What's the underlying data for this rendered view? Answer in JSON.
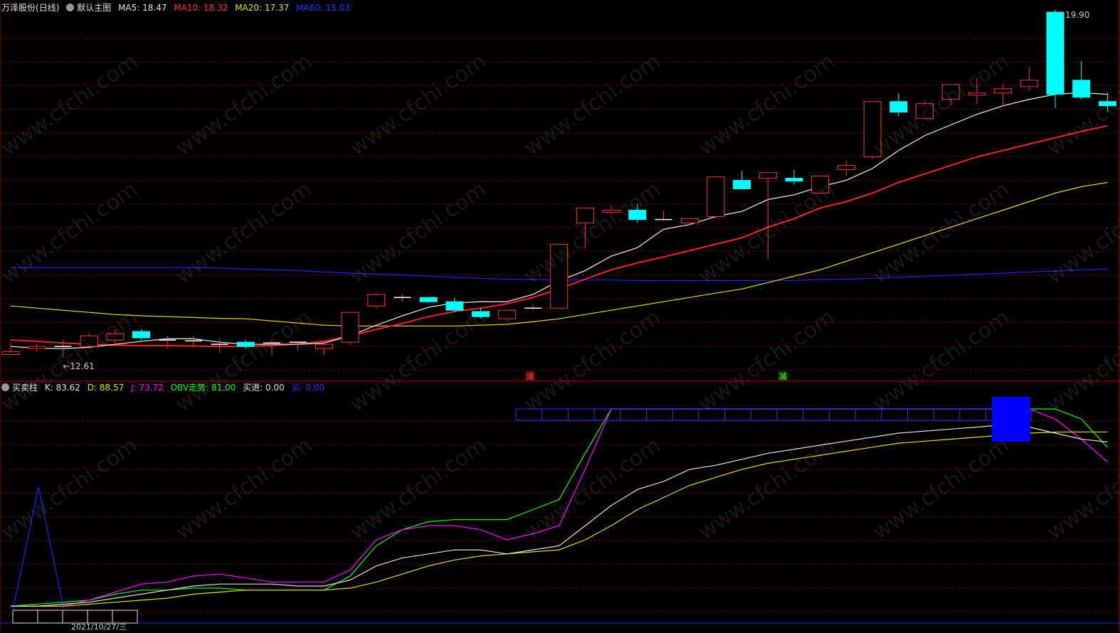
{
  "header_top": {
    "stock": "万泽股份",
    "period": "(日线)",
    "chart_name": "默认主图",
    "ma5": "MA5: 18.47",
    "ma10": "MA10: 18.32",
    "ma20": "MA20: 17.37",
    "ma60": "MA60: 15.03"
  },
  "header_bottom": {
    "name": "买卖柱",
    "k": "K: 83.62",
    "d": "D: 88.57",
    "j": "J: 73.72",
    "obv": "OBV走势: 81.00",
    "buy_in": "买进: 0.00",
    "buy": "买: 0.00"
  },
  "markers": {
    "high": "19.90",
    "low": "12.61",
    "zhang": "涨",
    "jian": "减"
  },
  "bottom_date": "2021/10/27/三",
  "watermark": "www.cfchi.com",
  "colors": {
    "up": "#ff3232",
    "down": "#00ffff",
    "ma5": "#e0e0e0",
    "ma10": "#ff2020",
    "ma20": "#e0e000",
    "ma60": "#2020ff",
    "k": "#e0e0e0",
    "d": "#e0e000",
    "j": "#ff00ff",
    "obv": "#00ff00",
    "grid": "#6a0000"
  },
  "chart_data": [
    {
      "type": "candlestick",
      "title": "万泽股份 (日线)",
      "ylim": [
        12.0,
        20.6
      ],
      "ohlc": [
        [
          12.61,
          12.88,
          12.61,
          12.68
        ],
        [
          12.75,
          12.85,
          12.68,
          12.8
        ],
        [
          12.8,
          12.95,
          12.55,
          12.8
        ],
        [
          12.8,
          13.1,
          12.75,
          13.05
        ],
        [
          12.95,
          13.2,
          12.85,
          13.1
        ],
        [
          13.15,
          13.2,
          12.95,
          13.0
        ],
        [
          12.95,
          13.05,
          12.75,
          12.95
        ],
        [
          12.93,
          13.05,
          12.78,
          12.93
        ],
        [
          12.85,
          12.98,
          12.65,
          12.85
        ],
        [
          12.9,
          12.95,
          12.75,
          12.8
        ],
        [
          12.88,
          12.95,
          12.6,
          12.88
        ],
        [
          12.88,
          12.9,
          12.7,
          12.9
        ],
        [
          12.75,
          12.95,
          12.6,
          12.85
        ],
        [
          12.9,
          13.6,
          12.85,
          13.6
        ],
        [
          13.75,
          14.05,
          13.7,
          14.02
        ],
        [
          13.95,
          14.02,
          13.85,
          13.95
        ],
        [
          13.95,
          13.95,
          13.82,
          13.85
        ],
        [
          13.85,
          13.95,
          13.6,
          13.65
        ],
        [
          13.62,
          13.7,
          13.45,
          13.5
        ],
        [
          13.45,
          13.65,
          13.4,
          13.65
        ],
        [
          13.7,
          13.78,
          13.65,
          13.7
        ],
        [
          13.7,
          15.2,
          13.7,
          15.2
        ],
        [
          15.7,
          16.05,
          15.1,
          16.05
        ],
        [
          15.95,
          16.1,
          15.9,
          16.0
        ],
        [
          16.0,
          16.15,
          15.7,
          15.78
        ],
        [
          15.78,
          15.98,
          15.76,
          15.78
        ],
        [
          15.7,
          15.8,
          15.65,
          15.8
        ],
        [
          15.85,
          16.8,
          15.8,
          16.78
        ],
        [
          16.7,
          16.92,
          16.5,
          16.5
        ],
        [
          16.75,
          16.82,
          14.85,
          16.88
        ],
        [
          16.75,
          16.95,
          16.6,
          16.68
        ],
        [
          16.4,
          16.76,
          16.38,
          16.8
        ],
        [
          16.95,
          17.15,
          16.8,
          17.05
        ],
        [
          17.25,
          18.4,
          17.2,
          18.55
        ],
        [
          18.55,
          18.75,
          18.2,
          18.3
        ],
        [
          18.15,
          18.55,
          18.15,
          18.5
        ],
        [
          18.6,
          18.95,
          18.45,
          18.95
        ],
        [
          18.7,
          19.1,
          18.5,
          18.75
        ],
        [
          18.75,
          18.95,
          18.45,
          18.85
        ],
        [
          18.9,
          19.35,
          18.8,
          19.05
        ],
        [
          20.65,
          20.7,
          18.4,
          18.72
        ],
        [
          19.05,
          19.5,
          18.6,
          18.65
        ],
        [
          18.55,
          18.75,
          18.3,
          18.45
        ]
      ],
      "ma5": [
        12.8,
        12.76,
        12.75,
        12.78,
        12.85,
        12.92,
        12.98,
        12.98,
        12.9,
        12.85,
        12.85,
        12.85,
        12.88,
        13.05,
        13.3,
        13.52,
        13.72,
        13.82,
        13.85,
        13.85,
        14.02,
        14.34,
        14.58,
        14.92,
        15.12,
        15.55,
        15.66,
        15.85,
        15.97,
        16.25,
        16.36,
        16.55,
        16.7,
        16.98,
        17.4,
        17.75,
        18.0,
        18.25,
        18.45,
        18.6,
        18.72,
        18.76,
        18.72
      ],
      "ma10": [
        12.95,
        12.92,
        12.88,
        12.85,
        12.83,
        12.82,
        12.82,
        12.81,
        12.8,
        12.8,
        12.82,
        12.86,
        12.92,
        13.05,
        13.2,
        13.34,
        13.5,
        13.62,
        13.7,
        13.8,
        13.95,
        14.15,
        14.38,
        14.6,
        14.76,
        14.9,
        15.05,
        15.2,
        15.35,
        15.6,
        15.8,
        16.05,
        16.2,
        16.4,
        16.65,
        16.85,
        17.05,
        17.25,
        17.4,
        17.55,
        17.7,
        17.85,
        17.98
      ],
      "ma20": [
        13.75,
        13.7,
        13.65,
        13.6,
        13.55,
        13.52,
        13.5,
        13.48,
        13.46,
        13.45,
        13.4,
        13.35,
        13.3,
        13.28,
        13.28,
        13.28,
        13.28,
        13.28,
        13.3,
        13.32,
        13.38,
        13.45,
        13.55,
        13.65,
        13.75,
        13.85,
        13.95,
        14.05,
        14.15,
        14.3,
        14.45,
        14.6,
        14.8,
        15.0,
        15.2,
        15.4,
        15.6,
        15.8,
        16.0,
        16.2,
        16.4,
        16.55,
        16.65
      ],
      "ma60": [
        14.65,
        14.65,
        14.65,
        14.65,
        14.65,
        14.65,
        14.65,
        14.65,
        14.64,
        14.62,
        14.6,
        14.58,
        14.55,
        14.52,
        14.5,
        14.48,
        14.45,
        14.42,
        14.4,
        14.38,
        14.37,
        14.36,
        14.36,
        14.36,
        14.35,
        14.35,
        14.35,
        14.35,
        14.35,
        14.35,
        14.35,
        14.37,
        14.38,
        14.4,
        14.42,
        14.45,
        14.47,
        14.5,
        14.52,
        14.55,
        14.57,
        14.6,
        14.62
      ]
    },
    {
      "type": "line",
      "title": "买卖柱",
      "ylim": [
        0,
        100
      ],
      "series": [
        {
          "name": "K",
          "values": [
            2,
            2,
            3,
            4,
            6,
            8,
            10,
            12,
            13,
            13,
            13,
            12,
            12,
            15,
            22,
            26,
            28,
            30,
            30,
            28,
            30,
            32,
            42,
            52,
            60,
            64,
            70,
            72,
            75,
            78,
            80,
            82,
            84,
            86,
            88,
            89,
            90,
            91,
            92,
            91,
            88,
            85,
            83.62
          ]
        },
        {
          "name": "D",
          "values": [
            2,
            2,
            2,
            3,
            4,
            5,
            6,
            8,
            9,
            10,
            10,
            10,
            10,
            11,
            14,
            18,
            22,
            25,
            27,
            28,
            29,
            30,
            35,
            42,
            50,
            56,
            62,
            66,
            70,
            73,
            75,
            77,
            79,
            81,
            83,
            84,
            85,
            86,
            87,
            88,
            88.5,
            88.6,
            88.57
          ]
        },
        {
          "name": "J",
          "values": [
            2,
            2,
            2,
            5,
            9,
            13,
            14,
            17,
            18,
            16,
            14,
            14,
            14,
            20,
            35,
            40,
            42,
            42,
            40,
            35,
            38,
            42,
            70,
            100,
            100,
            100,
            100,
            100,
            100,
            100,
            100,
            100,
            100,
            100,
            100,
            100,
            100,
            100,
            100,
            100,
            95,
            85,
            73.72
          ]
        },
        {
          "name": "OBV走势",
          "values": [
            2,
            3,
            4,
            5,
            8,
            10,
            10,
            11,
            11,
            10,
            10,
            10,
            10,
            17,
            32,
            40,
            44,
            45,
            45,
            45,
            50,
            55,
            78,
            100,
            100,
            100,
            100,
            100,
            100,
            100,
            100,
            100,
            100,
            100,
            100,
            100,
            100,
            100,
            100,
            100,
            100,
            95,
            81
          ]
        }
      ]
    }
  ]
}
